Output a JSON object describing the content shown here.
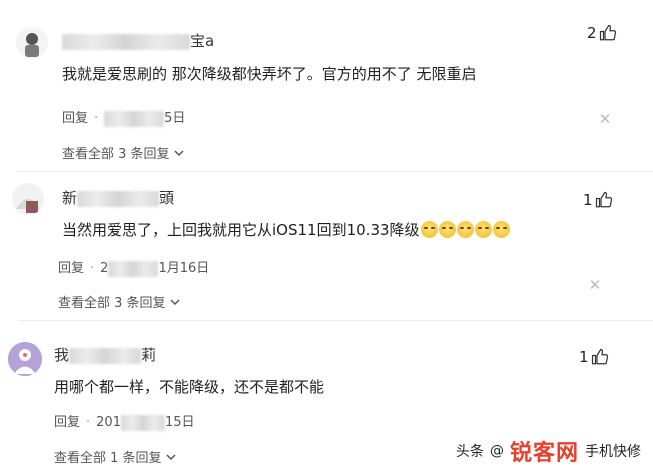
{
  "comments": [
    {
      "name_suffix": "宝a",
      "text": "我就是爱思刷的 那次降级都快弄坏了。官方的用不了 无限重启",
      "reply_label": "回复",
      "date_suffix": "5日",
      "expand": "查看全部 3 条回复",
      "likes": "2"
    },
    {
      "name_prefix": "新",
      "name_suffix": "頭",
      "text": "当然用爱思了，上回我就用它从iOS11回到10.33降级",
      "reply_label": "回复",
      "date_prefix": "2",
      "date_suffix": "1月16日",
      "expand": "查看全部 3 条回复",
      "likes": "1"
    },
    {
      "name_prefix": "我",
      "name_suffix": "莉",
      "text": "用哪个都一样，不能降级，还不是都不能",
      "reply_label": "回复",
      "date_prefix": "201",
      "date_suffix": "15日",
      "expand": "查看全部 1 条回复",
      "likes": "1"
    }
  ],
  "watermark": {
    "source": "头条",
    "at": "@",
    "logo": "锐客网",
    "tail": "手机快修"
  },
  "icons": {
    "like": "thumbs-up-icon",
    "expand": "chevron-down-icon",
    "close": "close-icon"
  }
}
